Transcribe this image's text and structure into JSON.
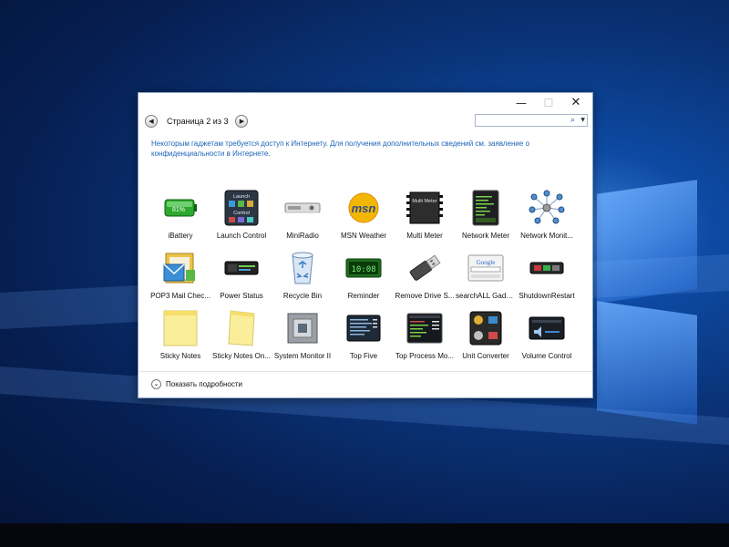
{
  "window": {
    "minimize_glyph": "—",
    "maximize_glyph": "☐",
    "close_glyph": "✕"
  },
  "nav": {
    "prev_glyph": "◀",
    "next_glyph": "▶",
    "page_label": "Страница 2 из 3"
  },
  "search": {
    "placeholder": "",
    "icon": "search-icon",
    "dropdown_glyph": "▼"
  },
  "notice": "Некоторым гаджетам требуется доступ к Интернету. Для получения дополнительных сведений см. заявление о конфиденциальности в Интернете.",
  "gadgets": [
    {
      "label": "iBattery",
      "icon": "battery-icon"
    },
    {
      "label": "Launch Control",
      "icon": "launch-control-icon"
    },
    {
      "label": "MiniRadio",
      "icon": "radio-icon"
    },
    {
      "label": "MSN Weather",
      "icon": "msn-icon"
    },
    {
      "label": "Multi Meter",
      "icon": "multi-meter-icon"
    },
    {
      "label": "Network Meter",
      "icon": "network-meter-icon"
    },
    {
      "label": "Network Monit...",
      "icon": "network-monitor-icon"
    },
    {
      "label": "POP3 Mail Chec...",
      "icon": "mail-icon"
    },
    {
      "label": "Power Status",
      "icon": "power-status-icon"
    },
    {
      "label": "Recycle Bin",
      "icon": "recycle-bin-icon"
    },
    {
      "label": "Reminder",
      "icon": "reminder-icon"
    },
    {
      "label": "Remove Drive S...",
      "icon": "usb-drive-icon"
    },
    {
      "label": "searchALL Gadg...",
      "icon": "google-search-icon"
    },
    {
      "label": "ShutdownRestart",
      "icon": "shutdown-icon"
    },
    {
      "label": "Sticky Notes",
      "icon": "sticky-note-icon"
    },
    {
      "label": "Sticky Notes On...",
      "icon": "sticky-note-online-icon"
    },
    {
      "label": "System Monitor II",
      "icon": "cpu-icon"
    },
    {
      "label": "Top Five",
      "icon": "top-five-icon"
    },
    {
      "label": "Top Process Mo...",
      "icon": "top-process-icon"
    },
    {
      "label": "Unit Converter",
      "icon": "unit-converter-icon"
    },
    {
      "label": "Volume Control",
      "icon": "volume-icon"
    }
  ],
  "gadget_texts": {
    "battery_pct": "81%",
    "launch_title": "Launch",
    "launch_sub": "Control",
    "msn": "msn",
    "multi_meter": "Multi Meter",
    "reminder_time": "10:08",
    "google": "Google"
  },
  "footer": {
    "chevron_glyph": "⌄",
    "details_label": "Показать подробности"
  }
}
